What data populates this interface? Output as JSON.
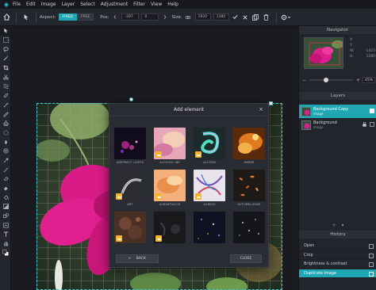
{
  "menu": [
    "File",
    "Edit",
    "Image",
    "Layer",
    "Select",
    "Adjustment",
    "Filter",
    "View",
    "Help"
  ],
  "options": {
    "aspect_label": "Aspect:",
    "aspect_options": [
      "FIXED",
      "FREE"
    ],
    "pos_label": "Pos:",
    "pos_x": "-297",
    "pos_y": "0",
    "size_label": "Size:",
    "size_w": "1920",
    "size_h": "1280"
  },
  "navigator": {
    "title": "Navigator",
    "labels": [
      "X:",
      "Y:",
      "W:",
      "H:"
    ],
    "values": [
      "",
      "",
      "1423",
      "1280"
    ],
    "zoom": "45%"
  },
  "layers": {
    "title": "Layers",
    "items": [
      {
        "name": "Background Copy",
        "type": "image"
      },
      {
        "name": "Background",
        "type": "image"
      }
    ]
  },
  "history": {
    "title": "History",
    "items": [
      "Open",
      "Crop",
      "Brightness & contrast",
      "Duplicate image"
    ]
  },
  "modal": {
    "title": "Add element",
    "tiles": [
      "ABSTRACT LIGHTS",
      "ALCOHOL INK",
      "ALCORN",
      "AMBER",
      "ART",
      "AURANTIACUS",
      "AUREUS",
      "AUTUMN LEAVE",
      "",
      "",
      "",
      ""
    ],
    "back_label": "BACK",
    "close_label": "CLOSE"
  },
  "colors": {
    "accent": "#1fa7b3",
    "badge": "#f0b430",
    "panel": "#23252c",
    "canvas_bg": "#1a1b20"
  }
}
